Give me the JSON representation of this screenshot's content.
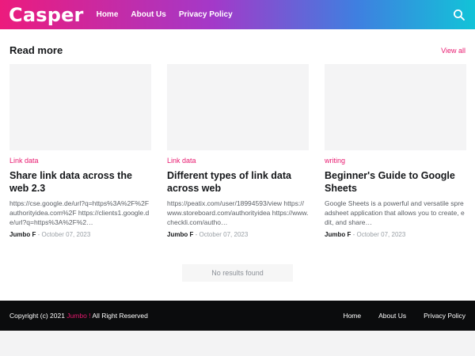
{
  "header": {
    "logo": "Casper",
    "nav": [
      "Home",
      "About Us",
      "Privacy Policy"
    ],
    "search_icon": "search-icon"
  },
  "section": {
    "title": "Read more",
    "view_all": "View all"
  },
  "cards": [
    {
      "tag": "Link data",
      "title": "Share link data across the web 2.3",
      "excerpt": "https://cse.google.de/url?q=https%3A%2F%2Fauthorityidea.com%2F https://clients1.google.de/url?q=https%3A%2F%2…",
      "author": "Jumbo F",
      "date": "October 07, 2023"
    },
    {
      "tag": "Link data",
      "title": "Different types of link data across web",
      "excerpt": "https://peatix.com/user/18994593/view https://www.storeboard.com/authorityidea https://www.checkli.com/autho…",
      "author": "Jumbo F",
      "date": "October 07, 2023"
    },
    {
      "tag": "writing",
      "title": "Beginner's Guide to Google Sheets",
      "excerpt": "Google Sheets is a powerful and versatile spreadsheet application that allows you to create, edit, and share…",
      "author": "Jumbo F",
      "date": "October 07, 2023"
    }
  ],
  "no_results": "No results found",
  "footer": {
    "copyright_prefix": "Copyright (c) 2021",
    "brand": "Jumbo !",
    "copyright_suffix": "All Right Reserved",
    "nav": [
      "Home",
      "About Us",
      "Privacy Policy"
    ]
  },
  "colors": {
    "accent": "#e8196f",
    "footer_bg": "#0b0c0d"
  }
}
